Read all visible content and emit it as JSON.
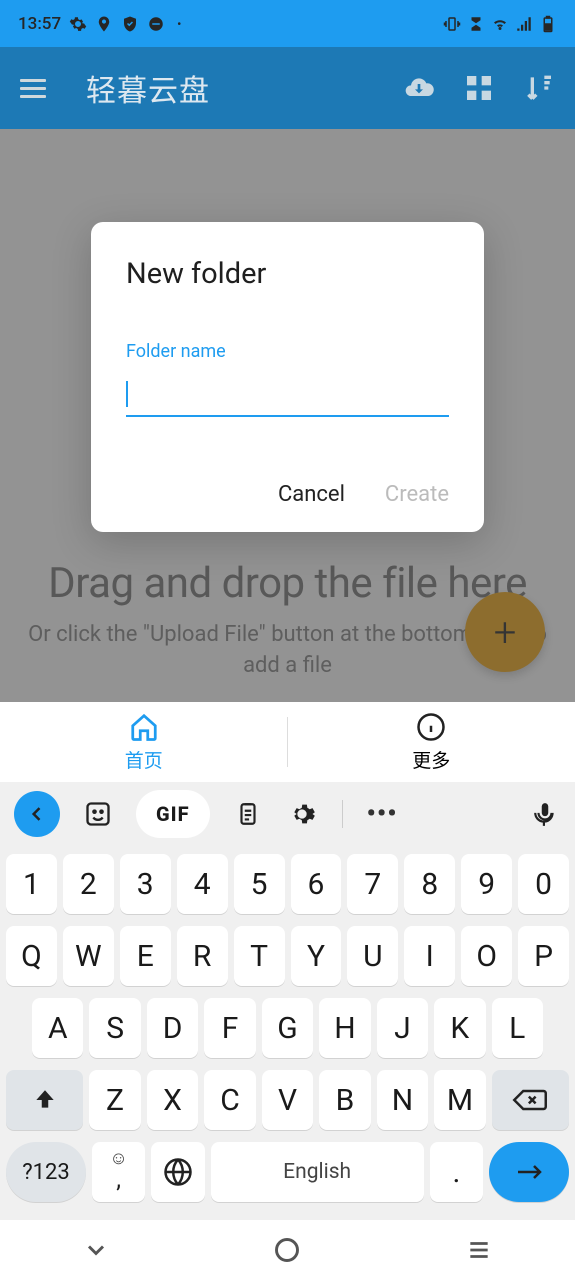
{
  "status": {
    "time": "13:57"
  },
  "app": {
    "title": "轻暮云盘"
  },
  "content": {
    "drag_text": "Drag and drop the file here",
    "hint": "Or click the \"Upload File\" button at the bottom right to add a file"
  },
  "dialog": {
    "title": "New folder",
    "label": "Folder name",
    "value": "",
    "cancel": "Cancel",
    "create": "Create"
  },
  "tabs": {
    "home": "首页",
    "more": "更多"
  },
  "keyboard": {
    "gif": "GIF",
    "row1": [
      "1",
      "2",
      "3",
      "4",
      "5",
      "6",
      "7",
      "8",
      "9",
      "0"
    ],
    "row2": [
      "Q",
      "W",
      "E",
      "R",
      "T",
      "Y",
      "U",
      "I",
      "O",
      "P"
    ],
    "row3": [
      "A",
      "S",
      "D",
      "F",
      "G",
      "H",
      "J",
      "K",
      "L"
    ],
    "row4": [
      "Z",
      "X",
      "C",
      "V",
      "B",
      "N",
      "M"
    ],
    "sym": "?123",
    "comma_sub": ",",
    "space": "English",
    "period": "."
  }
}
